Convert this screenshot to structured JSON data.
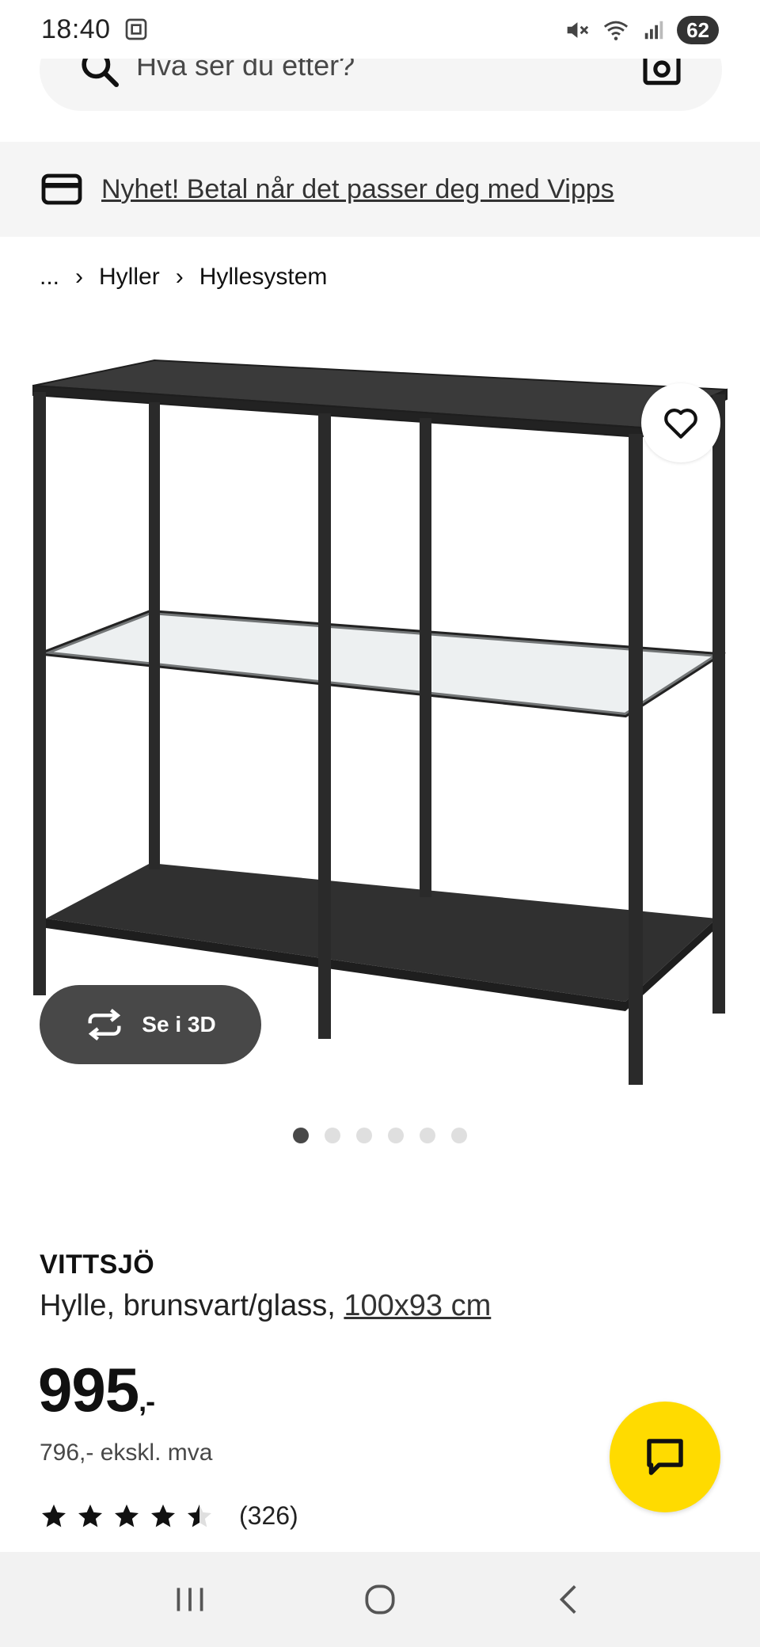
{
  "status_bar": {
    "time": "18:40",
    "battery": "62",
    "icons": [
      "screenshot-icon",
      "mute-icon",
      "wifi-icon",
      "signal-icon"
    ]
  },
  "search": {
    "placeholder": "Hva ser du etter?",
    "icons": [
      "search-icon",
      "camera-icon"
    ]
  },
  "banner": {
    "text": "Nyhet! Betal når det passer deg med Vipps",
    "icon": "credit-card-icon"
  },
  "breadcrumb": {
    "items": [
      "...",
      "Hyller",
      "Hyllesystem"
    ]
  },
  "gallery": {
    "view_3d_label": "Se i 3D",
    "dot_count": 6,
    "active_dot": 0
  },
  "product": {
    "brand": "VITTSJÖ",
    "description": "Hylle, brunsvart/glass,",
    "size": "100x93 cm",
    "price": "995",
    "price_suffix": ",-",
    "price_ex_vat": "796,- ekskl. mva",
    "rating": 4.5,
    "rating_max": 5,
    "review_count": "(326)"
  },
  "colors": {
    "accent_yellow": "#ffdb00",
    "dark_gray": "#484848",
    "light_gray": "#f5f5f5"
  },
  "nav": {
    "icons": [
      "recent-apps-icon",
      "home-icon",
      "back-icon"
    ]
  }
}
